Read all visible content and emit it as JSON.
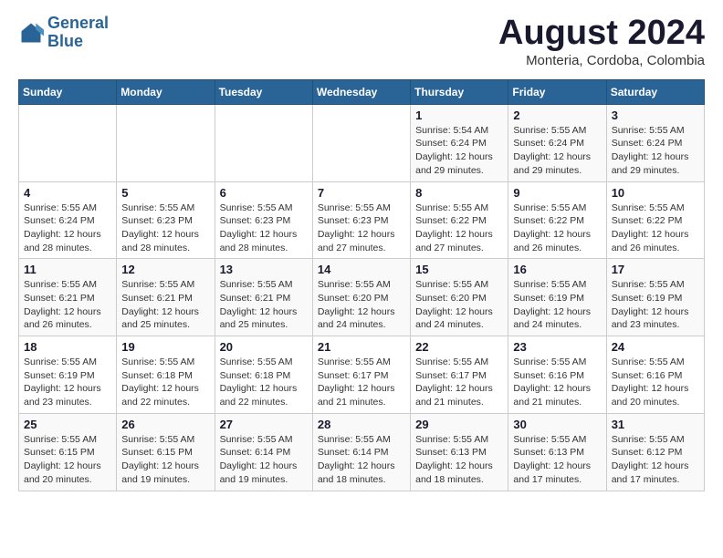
{
  "header": {
    "logo_line1": "General",
    "logo_line2": "Blue",
    "main_title": "August 2024",
    "subtitle": "Monteria, Cordoba, Colombia"
  },
  "days_of_week": [
    "Sunday",
    "Monday",
    "Tuesday",
    "Wednesday",
    "Thursday",
    "Friday",
    "Saturday"
  ],
  "weeks": [
    [
      {
        "day": "",
        "info": ""
      },
      {
        "day": "",
        "info": ""
      },
      {
        "day": "",
        "info": ""
      },
      {
        "day": "",
        "info": ""
      },
      {
        "day": "1",
        "info": "Sunrise: 5:54 AM\nSunset: 6:24 PM\nDaylight: 12 hours\nand 29 minutes."
      },
      {
        "day": "2",
        "info": "Sunrise: 5:55 AM\nSunset: 6:24 PM\nDaylight: 12 hours\nand 29 minutes."
      },
      {
        "day": "3",
        "info": "Sunrise: 5:55 AM\nSunset: 6:24 PM\nDaylight: 12 hours\nand 29 minutes."
      }
    ],
    [
      {
        "day": "4",
        "info": "Sunrise: 5:55 AM\nSunset: 6:24 PM\nDaylight: 12 hours\nand 28 minutes."
      },
      {
        "day": "5",
        "info": "Sunrise: 5:55 AM\nSunset: 6:23 PM\nDaylight: 12 hours\nand 28 minutes."
      },
      {
        "day": "6",
        "info": "Sunrise: 5:55 AM\nSunset: 6:23 PM\nDaylight: 12 hours\nand 28 minutes."
      },
      {
        "day": "7",
        "info": "Sunrise: 5:55 AM\nSunset: 6:23 PM\nDaylight: 12 hours\nand 27 minutes."
      },
      {
        "day": "8",
        "info": "Sunrise: 5:55 AM\nSunset: 6:22 PM\nDaylight: 12 hours\nand 27 minutes."
      },
      {
        "day": "9",
        "info": "Sunrise: 5:55 AM\nSunset: 6:22 PM\nDaylight: 12 hours\nand 26 minutes."
      },
      {
        "day": "10",
        "info": "Sunrise: 5:55 AM\nSunset: 6:22 PM\nDaylight: 12 hours\nand 26 minutes."
      }
    ],
    [
      {
        "day": "11",
        "info": "Sunrise: 5:55 AM\nSunset: 6:21 PM\nDaylight: 12 hours\nand 26 minutes."
      },
      {
        "day": "12",
        "info": "Sunrise: 5:55 AM\nSunset: 6:21 PM\nDaylight: 12 hours\nand 25 minutes."
      },
      {
        "day": "13",
        "info": "Sunrise: 5:55 AM\nSunset: 6:21 PM\nDaylight: 12 hours\nand 25 minutes."
      },
      {
        "day": "14",
        "info": "Sunrise: 5:55 AM\nSunset: 6:20 PM\nDaylight: 12 hours\nand 24 minutes."
      },
      {
        "day": "15",
        "info": "Sunrise: 5:55 AM\nSunset: 6:20 PM\nDaylight: 12 hours\nand 24 minutes."
      },
      {
        "day": "16",
        "info": "Sunrise: 5:55 AM\nSunset: 6:19 PM\nDaylight: 12 hours\nand 24 minutes."
      },
      {
        "day": "17",
        "info": "Sunrise: 5:55 AM\nSunset: 6:19 PM\nDaylight: 12 hours\nand 23 minutes."
      }
    ],
    [
      {
        "day": "18",
        "info": "Sunrise: 5:55 AM\nSunset: 6:19 PM\nDaylight: 12 hours\nand 23 minutes."
      },
      {
        "day": "19",
        "info": "Sunrise: 5:55 AM\nSunset: 6:18 PM\nDaylight: 12 hours\nand 22 minutes."
      },
      {
        "day": "20",
        "info": "Sunrise: 5:55 AM\nSunset: 6:18 PM\nDaylight: 12 hours\nand 22 minutes."
      },
      {
        "day": "21",
        "info": "Sunrise: 5:55 AM\nSunset: 6:17 PM\nDaylight: 12 hours\nand 21 minutes."
      },
      {
        "day": "22",
        "info": "Sunrise: 5:55 AM\nSunset: 6:17 PM\nDaylight: 12 hours\nand 21 minutes."
      },
      {
        "day": "23",
        "info": "Sunrise: 5:55 AM\nSunset: 6:16 PM\nDaylight: 12 hours\nand 21 minutes."
      },
      {
        "day": "24",
        "info": "Sunrise: 5:55 AM\nSunset: 6:16 PM\nDaylight: 12 hours\nand 20 minutes."
      }
    ],
    [
      {
        "day": "25",
        "info": "Sunrise: 5:55 AM\nSunset: 6:15 PM\nDaylight: 12 hours\nand 20 minutes."
      },
      {
        "day": "26",
        "info": "Sunrise: 5:55 AM\nSunset: 6:15 PM\nDaylight: 12 hours\nand 19 minutes."
      },
      {
        "day": "27",
        "info": "Sunrise: 5:55 AM\nSunset: 6:14 PM\nDaylight: 12 hours\nand 19 minutes."
      },
      {
        "day": "28",
        "info": "Sunrise: 5:55 AM\nSunset: 6:14 PM\nDaylight: 12 hours\nand 18 minutes."
      },
      {
        "day": "29",
        "info": "Sunrise: 5:55 AM\nSunset: 6:13 PM\nDaylight: 12 hours\nand 18 minutes."
      },
      {
        "day": "30",
        "info": "Sunrise: 5:55 AM\nSunset: 6:13 PM\nDaylight: 12 hours\nand 17 minutes."
      },
      {
        "day": "31",
        "info": "Sunrise: 5:55 AM\nSunset: 6:12 PM\nDaylight: 12 hours\nand 17 minutes."
      }
    ]
  ]
}
